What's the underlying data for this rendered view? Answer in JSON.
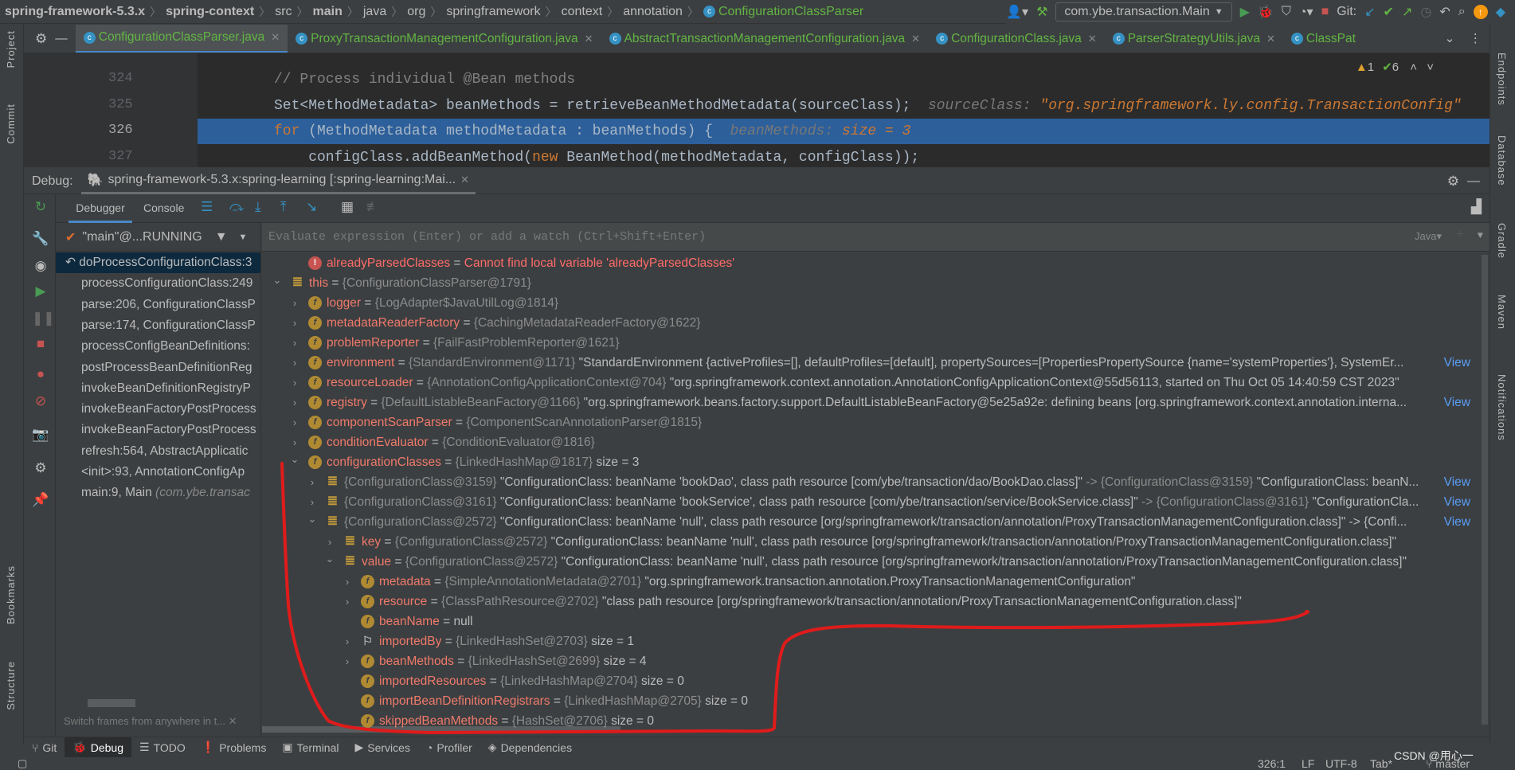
{
  "breadcrumb": [
    "spring-framework-5.3.x",
    "spring-context",
    "src",
    "main",
    "java",
    "org",
    "springframework",
    "context",
    "annotation",
    "ConfigurationClassParser"
  ],
  "toolbar": {
    "run_config": "com.ybe.transaction.Main",
    "git_label": "Git:"
  },
  "left_stripe": [
    "Project",
    "Commit",
    "Bookmarks",
    "Structure"
  ],
  "right_stripe": [
    "Endpoints",
    "Database",
    "Gradle",
    "Maven",
    "Notifications"
  ],
  "editor_tabs": [
    {
      "label": "ConfigurationClassParser.java",
      "selected": true
    },
    {
      "label": "ProxyTransactionManagementConfiguration.java"
    },
    {
      "label": "AbstractTransactionManagementConfiguration.java"
    },
    {
      "label": "ConfigurationClass.java"
    },
    {
      "label": "ParserStrategyUtils.java"
    },
    {
      "label": "ClassPat"
    }
  ],
  "inspections": {
    "warnings": "1",
    "ok": "6"
  },
  "code": {
    "lines": [
      {
        "num": "324",
        "text": "// Process individual @Bean methods"
      },
      {
        "num": "325",
        "text": "Set<MethodMetadata> beanMethods = retrieveBeanMethodMetadata(sourceClass);",
        "hint_name": "sourceClass:",
        "hint_value": "\"org.springframework.ly.config.TransactionConfig\""
      },
      {
        "num": "326",
        "keyword": "for",
        "text": " (MethodMetadata methodMetadata : beanMethods) {",
        "hint_name": "beanMethods:",
        "hint_value": "size = 3",
        "current": true
      },
      {
        "num": "327",
        "pre": "    configClass.addBeanMethod(",
        "keyword": "new",
        "text": " BeanMethod(methodMetadata, configClass));"
      }
    ]
  },
  "debug": {
    "label": "Debug:",
    "session": "spring-framework-5.3.x:spring-learning [:spring-learning:Mai...",
    "tabs": [
      "Debugger",
      "Console"
    ],
    "thread": "\"main\"@...RUNNING",
    "eval_placeholder": "Evaluate expression (Enter) or add a watch (Ctrl+Shift+Enter)",
    "language": "Java",
    "frames_hint": "Switch frames from anywhere in t...",
    "frames": [
      {
        "text": "doProcessConfigurationClass:3",
        "selected": true
      },
      {
        "text": "processConfigurationClass:249"
      },
      {
        "text": "parse:206, ConfigurationClassP"
      },
      {
        "text": "parse:174, ConfigurationClassP"
      },
      {
        "text": "processConfigBeanDefinitions:"
      },
      {
        "text": "postProcessBeanDefinitionReg"
      },
      {
        "text": "invokeBeanDefinitionRegistryP"
      },
      {
        "text": "invokeBeanFactoryPostProcess"
      },
      {
        "text": "invokeBeanFactoryPostProcess"
      },
      {
        "text": "refresh:564, AbstractApplicatic"
      },
      {
        "text": "<init>:93, AnnotationConfigAp"
      },
      {
        "text": "main:9, Main",
        "pkg": "(com.ybe.transac"
      }
    ],
    "variables": [
      {
        "level": 0,
        "arrow": "none",
        "icon": "error",
        "name": "alreadyParsedClasses",
        "error": "Cannot find local variable 'alreadyParsedClasses'"
      },
      {
        "level": -1,
        "arrow": "down",
        "icon": "object",
        "name": "this",
        "ref": "{ConfigurationClassParser@1791}"
      },
      {
        "level": 0,
        "arrow": "right",
        "icon": "field",
        "name": "logger",
        "ref": "{LogAdapter$JavaUtilLog@1814}"
      },
      {
        "level": 0,
        "arrow": "right",
        "icon": "field",
        "name": "metadataReaderFactory",
        "ref": "{CachingMetadataReaderFactory@1622}"
      },
      {
        "level": 0,
        "arrow": "right",
        "icon": "field",
        "name": "problemReporter",
        "ref": "{FailFastProblemReporter@1621}"
      },
      {
        "level": 0,
        "arrow": "right",
        "icon": "field",
        "name": "environment",
        "ref": "{StandardEnvironment@1171}",
        "value": "\"StandardEnvironment {activeProfiles=[], defaultProfiles=[default], propertySources=[PropertiesPropertySource {name='systemProperties'}, SystemEr...",
        "view": true
      },
      {
        "level": 0,
        "arrow": "right",
        "icon": "field",
        "name": "resourceLoader",
        "ref": "{AnnotationConfigApplicationContext@704}",
        "value": "\"org.springframework.context.annotation.AnnotationConfigApplicationContext@55d56113, started on Thu Oct 05 14:40:59 CST 2023\""
      },
      {
        "level": 0,
        "arrow": "right",
        "icon": "field",
        "name": "registry",
        "ref": "{DefaultListableBeanFactory@1166}",
        "value": "\"org.springframework.beans.factory.support.DefaultListableBeanFactory@5e25a92e: defining beans [org.springframework.context.annotation.interna...",
        "view": true
      },
      {
        "level": 0,
        "arrow": "right",
        "icon": "field",
        "name": "componentScanParser",
        "ref": "{ComponentScanAnnotationParser@1815}"
      },
      {
        "level": 0,
        "arrow": "right",
        "icon": "field",
        "name": "conditionEvaluator",
        "ref": "{ConditionEvaluator@1816}"
      },
      {
        "level": 0,
        "arrow": "down",
        "icon": "field",
        "name": "configurationClasses",
        "ref": "{LinkedHashMap@1817}",
        "value": "size = 3"
      },
      {
        "level": 1,
        "arrow": "right",
        "icon": "object",
        "ref": "{ConfigurationClass@3159}",
        "value": "\"ConfigurationClass: beanName 'bookDao', class path resource [com/ybe/transaction/dao/BookDao.class]\" -> {ConfigurationClass@3159} \"ConfigurationClass: beanN...",
        "view": true
      },
      {
        "level": 1,
        "arrow": "right",
        "icon": "object",
        "ref": "{ConfigurationClass@3161}",
        "value": "\"ConfigurationClass: beanName 'bookService', class path resource [com/ybe/transaction/service/BookService.class]\" -> {ConfigurationClass@3161} \"ConfigurationCla...",
        "view": true
      },
      {
        "level": 1,
        "arrow": "down",
        "icon": "object",
        "ref": "{ConfigurationClass@2572}",
        "value": "\"ConfigurationClass: beanName 'null', class path resource [org/springframework/transaction/annotation/ProxyTransactionManagementConfiguration.class]\" -> {Confi...",
        "view": true
      },
      {
        "level": 2,
        "arrow": "right",
        "icon": "object",
        "name": "key",
        "ref": "{ConfigurationClass@2572}",
        "value": "\"ConfigurationClass: beanName 'null', class path resource [org/springframework/transaction/annotation/ProxyTransactionManagementConfiguration.class]\""
      },
      {
        "level": 2,
        "arrow": "down",
        "icon": "object",
        "name": "value",
        "ref": "{ConfigurationClass@2572}",
        "value": "\"ConfigurationClass: beanName 'null', class path resource [org/springframework/transaction/annotation/ProxyTransactionManagementConfiguration.class]\""
      },
      {
        "level": 3,
        "arrow": "right",
        "icon": "field",
        "name": "metadata",
        "ref": "{SimpleAnnotationMetadata@2701}",
        "value": "\"org.springframework.transaction.annotation.ProxyTransactionManagementConfiguration\""
      },
      {
        "level": 3,
        "arrow": "right",
        "icon": "field",
        "name": "resource",
        "ref": "{ClassPathResource@2702}",
        "value": "\"class path resource [org/springframework/transaction/annotation/ProxyTransactionManagementConfiguration.class]\""
      },
      {
        "level": 3,
        "arrow": "none",
        "icon": "field",
        "name": "beanName",
        "value": "null"
      },
      {
        "level": 3,
        "arrow": "right",
        "icon": "flag",
        "name": "importedBy",
        "ref": "{LinkedHashSet@2703}",
        "value": "size = 1"
      },
      {
        "level": 3,
        "arrow": "right",
        "icon": "field",
        "name": "beanMethods",
        "ref": "{LinkedHashSet@2699}",
        "value": "size = 4"
      },
      {
        "level": 3,
        "arrow": "none",
        "icon": "field",
        "name": "importedResources",
        "ref": "{LinkedHashMap@2704}",
        "value": "size = 0"
      },
      {
        "level": 3,
        "arrow": "none",
        "icon": "field",
        "name": "importBeanDefinitionRegistrars",
        "ref": "{LinkedHashMap@2705}",
        "value": "size = 0"
      },
      {
        "level": 3,
        "arrow": "none",
        "icon": "field",
        "name": "skippedBeanMethods",
        "ref": "{HashSet@2706}",
        "value": "size = 0"
      }
    ],
    "view_label": "View"
  },
  "tool_windows": [
    {
      "label": "Git",
      "icon": "git-icon"
    },
    {
      "label": "Debug",
      "icon": "bug-icon",
      "selected": true
    },
    {
      "label": "TODO",
      "icon": "list-icon"
    },
    {
      "label": "Problems",
      "icon": "problems-icon"
    },
    {
      "label": "Terminal",
      "icon": "terminal-icon"
    },
    {
      "label": "Services",
      "icon": "services-icon"
    },
    {
      "label": "Profiler",
      "icon": "profiler-icon"
    },
    {
      "label": "Dependencies",
      "icon": "dependencies-icon"
    }
  ],
  "status": {
    "position": "326:1",
    "line_sep": "LF",
    "encoding": "UTF-8",
    "indent": "Tab*",
    "branch": "master"
  },
  "watermark": "CSDN @用心一",
  "colors": {
    "annotation": "#e01b1b",
    "current_line": "#2d5f9a",
    "field_name": "#f07a6b",
    "link": "#589df6"
  }
}
